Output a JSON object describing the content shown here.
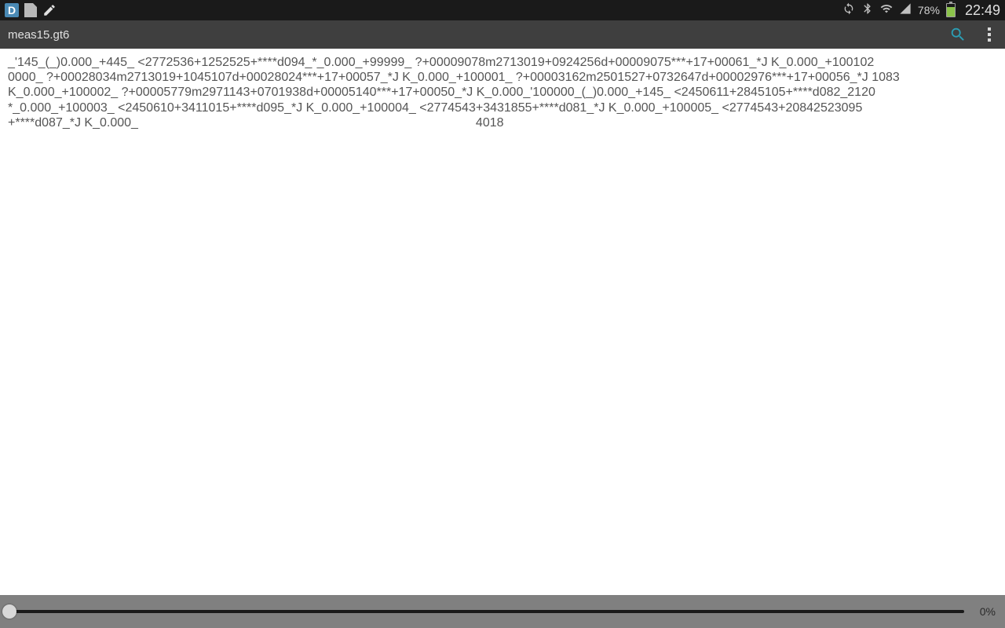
{
  "status_bar": {
    "battery_pct": "78%",
    "clock": "22:49"
  },
  "action_bar": {
    "title": "meas15.gt6"
  },
  "content": {
    "lines": [
      "_'145_(_)0.000_+445_ <2772536+1252525+****d094_*_0.000_+99999_ ?+00009078m2713019+0924256d+00009075***+17+00061_*J K_0.000_+100102",
      "0000_ ?+00028034m2713019+1045107d+00028024***+17+00057_*J K_0.000_+100001_ ?+00003162m2501527+0732647d+00002976***+17+00056_*J 1083",
      "K_0.000_+100002_ ?+00005779m2971143+0701938d+00005140***+17+00050_*J K_0.000_'100000_(_)0.000_+145_ <2450611+2845105+****d082_2120",
      "*_0.000_+100003_ <2450610+3411015+****d095_*J K_0.000_+100004_ <2774543+3431855+****d081_*J K_0.000_+100005_ <2774543+20842523095"
    ],
    "trailing_left": "+****d087_*J K_0.000_",
    "trailing_right": "4018"
  },
  "bottom_bar": {
    "progress_pct": "0%"
  }
}
